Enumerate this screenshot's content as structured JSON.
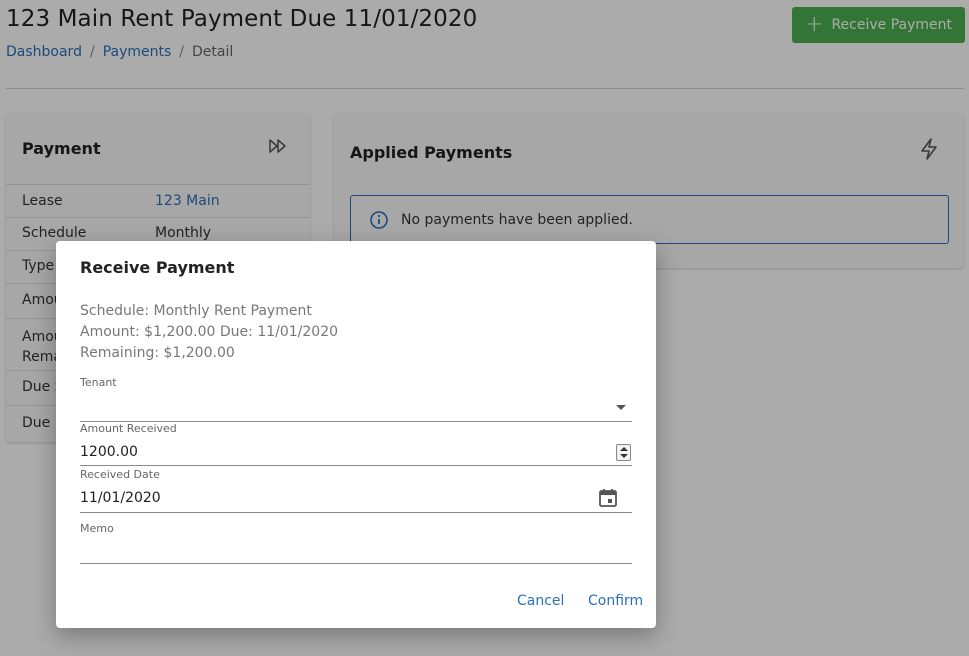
{
  "header": {
    "title": "123 Main Rent Payment Due 11/01/2020",
    "breadcrumb": [
      "Dashboard",
      "Payments",
      "Detail"
    ],
    "separator": "/",
    "receive_button": "Receive Payment"
  },
  "payment_card": {
    "title": "Payment",
    "rows": [
      {
        "label": "Lease",
        "value": "123 Main"
      },
      {
        "label": "Schedule",
        "value": "Monthly"
      },
      {
        "label": "Type",
        "value": ""
      },
      {
        "label": "Amou",
        "value": ""
      },
      {
        "label": "Amou\nRema",
        "value": ""
      },
      {
        "label": "Due S",
        "value": ""
      },
      {
        "label": "Due D",
        "value": ""
      }
    ]
  },
  "applied_card": {
    "title": "Applied Payments",
    "info": "No payments have been applied."
  },
  "modal": {
    "title": "Receive Payment",
    "info_lines": [
      "Schedule: Monthly Rent Payment",
      "Amount: $1,200.00 Due: 11/01/2020",
      "Remaining: $1,200.00"
    ],
    "tenant_label": "Tenant",
    "tenant_value": "",
    "amount_label": "Amount Received",
    "amount_value": "1200.00",
    "date_label": "Received Date",
    "date_value": "11/01/2020",
    "memo_label": "Memo",
    "memo_value": "",
    "cancel": "Cancel",
    "confirm": "Confirm"
  },
  "colors": {
    "accent": "#2a6fba",
    "success": "#4caf50"
  }
}
